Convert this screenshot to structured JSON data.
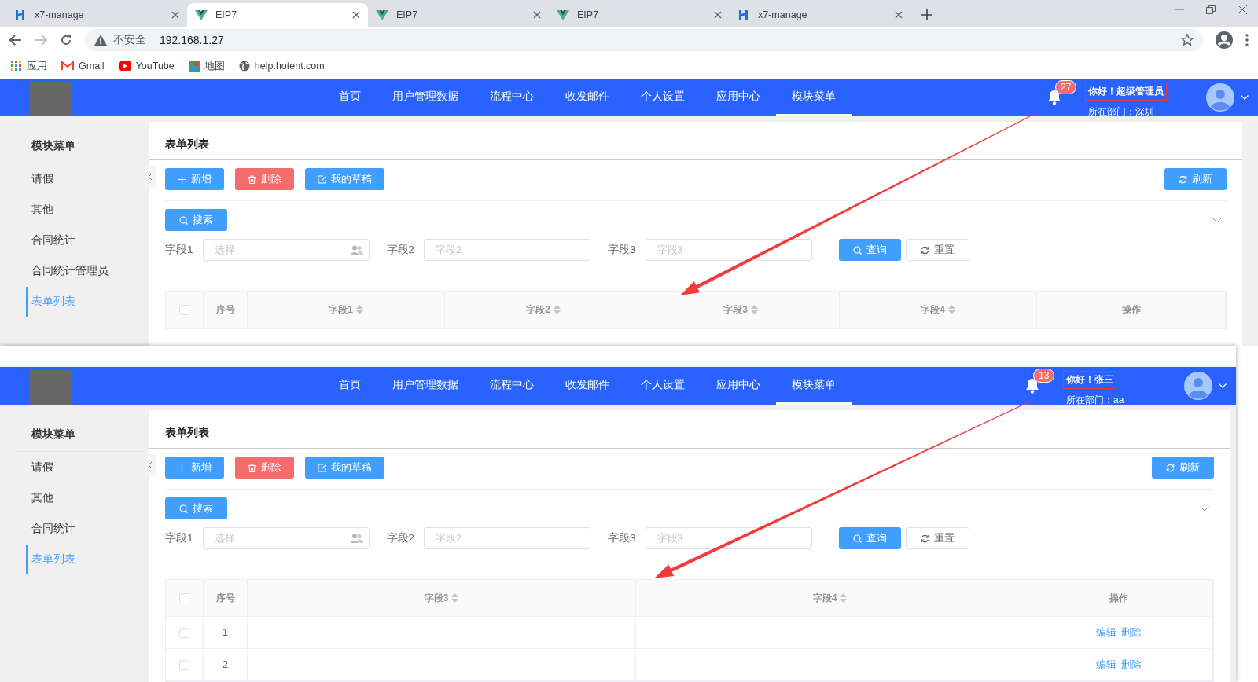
{
  "browser": {
    "tabs": [
      {
        "title": "x7-manage",
        "kind": "manage",
        "selected": false
      },
      {
        "title": "EIP7",
        "kind": "eip",
        "selected": true
      },
      {
        "title": "EIP7",
        "kind": "eip",
        "selected": false
      },
      {
        "title": "EIP7",
        "kind": "eip",
        "selected": false
      },
      {
        "title": "x7-manage",
        "kind": "manage",
        "selected": false
      }
    ],
    "security": "不安全",
    "url": "192.168.1.27",
    "bookmarks": [
      {
        "label": "应用",
        "kind": "apps"
      },
      {
        "label": "Gmail",
        "kind": "mail"
      },
      {
        "label": "YouTube",
        "kind": "video"
      },
      {
        "label": "地图",
        "kind": "map"
      },
      {
        "label": "help.hotent.com",
        "kind": "globe"
      }
    ]
  },
  "screens": [
    {
      "nav": [
        {
          "label": "首页",
          "selected": false
        },
        {
          "label": "用户管理数据",
          "selected": false
        },
        {
          "label": "流程中心",
          "selected": false
        },
        {
          "label": "收发邮件",
          "selected": false
        },
        {
          "label": "个人设置",
          "selected": false
        },
        {
          "label": "应用中心",
          "selected": false
        },
        {
          "label": "模块菜单",
          "selected": true
        }
      ],
      "notifications": "27",
      "greeting": "你好！超级管理员",
      "highlighted": true,
      "department": "所在部门：深圳",
      "sidebar": {
        "title": "模块菜单",
        "items": [
          {
            "label": "请假",
            "selected": false
          },
          {
            "label": "其他",
            "selected": false
          },
          {
            "label": "合同统计",
            "selected": false
          },
          {
            "label": "合同统计管理员",
            "selected": false
          },
          {
            "label": "表单列表",
            "selected": true
          }
        ]
      },
      "panel_title": "表单列表",
      "toolbar": [
        {
          "label": "新增",
          "kind": "add"
        },
        {
          "label": "删除",
          "kind": "delete"
        },
        {
          "label": "我的草稿",
          "kind": "draft"
        }
      ],
      "refresh": "刷新",
      "search_toggle": "搜索",
      "filters": [
        {
          "label": "字段1",
          "placeholder": "选择",
          "kind": "picker"
        },
        {
          "label": "字段2",
          "placeholder": "字段2",
          "kind": "text"
        },
        {
          "label": "字段3",
          "placeholder": "字段3",
          "kind": "text"
        }
      ],
      "query": "查询",
      "reset": "重置",
      "table": {
        "all_checked": false,
        "columns": [
          {
            "label": "序号",
            "sortable": false,
            "kind": "index"
          },
          {
            "label": "字段1",
            "sortable": true,
            "kind": "field"
          },
          {
            "label": "字段2",
            "sortable": true,
            "kind": "field"
          },
          {
            "label": "字段3",
            "sortable": true,
            "kind": "field"
          },
          {
            "label": "字段4",
            "sortable": true,
            "kind": "field"
          },
          {
            "label": "操作",
            "sortable": false,
            "kind": "actions"
          }
        ]
      }
    },
    {
      "nav": [
        {
          "label": "首页",
          "selected": false
        },
        {
          "label": "用户管理数据",
          "selected": false
        },
        {
          "label": "流程中心",
          "selected": false
        },
        {
          "label": "收发邮件",
          "selected": false
        },
        {
          "label": "个人设置",
          "selected": false
        },
        {
          "label": "应用中心",
          "selected": false
        },
        {
          "label": "模块菜单",
          "selected": true
        }
      ],
      "notifications": "13",
      "greeting": "你好！张三",
      "highlighted": true,
      "department": "所在部门：aa",
      "sidebar": {
        "title": "模块菜单",
        "items": [
          {
            "label": "请假",
            "selected": false
          },
          {
            "label": "其他",
            "selected": false
          },
          {
            "label": "合同统计",
            "selected": false
          },
          {
            "label": "表单列表",
            "selected": true
          }
        ]
      },
      "panel_title": "表单列表",
      "toolbar": [
        {
          "label": "新增",
          "kind": "add"
        },
        {
          "label": "删除",
          "kind": "delete"
        },
        {
          "label": "我的草稿",
          "kind": "draft"
        }
      ],
      "refresh": "刷新",
      "search_toggle": "搜索",
      "filters": [
        {
          "label": "字段1",
          "placeholder": "选择",
          "kind": "picker"
        },
        {
          "label": "字段2",
          "placeholder": "字段2",
          "kind": "text"
        },
        {
          "label": "字段3",
          "placeholder": "字段3",
          "kind": "text"
        }
      ],
      "query": "查询",
      "reset": "重置",
      "table": {
        "all_checked": false,
        "columns": [
          {
            "label": "序号",
            "sortable": false,
            "kind": "index"
          },
          {
            "label": "字段3",
            "sortable": true,
            "kind": "field"
          },
          {
            "label": "字段4",
            "sortable": true,
            "kind": "field"
          },
          {
            "label": "操作",
            "sortable": false,
            "kind": "actions"
          }
        ],
        "rows": [
          {
            "index": "1",
            "checked": false,
            "actions": [
              "编辑",
              "删除"
            ]
          },
          {
            "index": "2",
            "checked": false,
            "actions": [
              "编辑",
              "删除"
            ]
          }
        ]
      }
    }
  ]
}
